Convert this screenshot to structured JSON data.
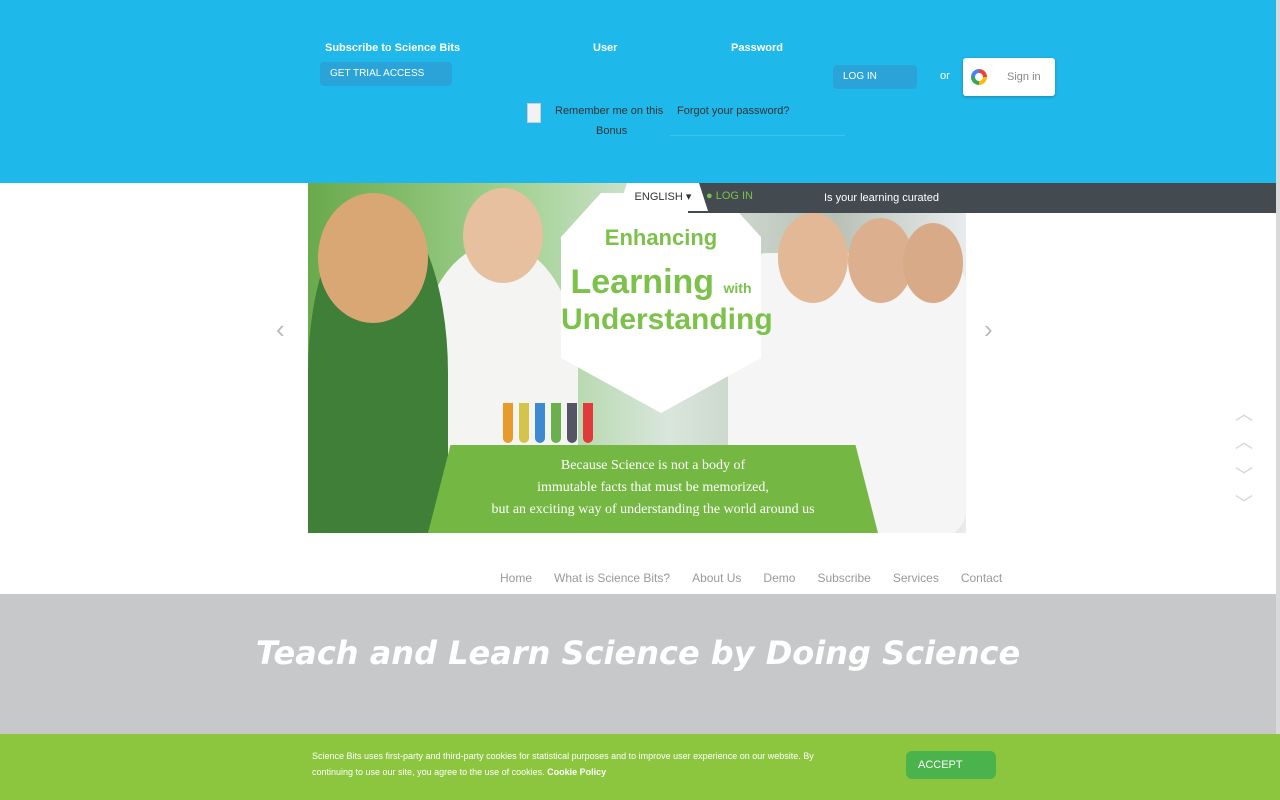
{
  "topbar": {
    "subscribe_label": "Subscribe to Science Bits",
    "subscribe_button": "GET TRIAL ACCESS",
    "user_label": "User",
    "password_label": "Password",
    "login_button": "LOG IN",
    "or_text": "or",
    "google_label": "Sign in",
    "remember_text": "Remember me on this",
    "forgot_link": "Forgot your password?",
    "bonus_text": "Bonus"
  },
  "overlay": {
    "language": "ENGLISH",
    "login": "LOG IN",
    "tagline": "Is your learning curated"
  },
  "slider": {
    "hex_line1": "Enhancing",
    "hex_line2": "Learning",
    "hex_line2_small": "with",
    "hex_line3": "Understanding",
    "caption_line1": "Because Science is not a body of",
    "caption_line2": "immutable facts that must be memorized,",
    "caption_line3": "but an exciting way of understanding the world around us",
    "arrow_left": "‹",
    "arrow_right": "›"
  },
  "side_nav": [
    "︿",
    "︿",
    "﹀",
    "﹀"
  ],
  "nav": {
    "items": [
      "Home",
      "What is Science Bits?",
      "About Us",
      "Demo",
      "Subscribe",
      "Services",
      "Contact"
    ]
  },
  "banner": {
    "title": "Teach and Learn Science by Doing Science"
  },
  "cookie": {
    "text": "Science Bits uses first-party and third-party cookies for statistical purposes and to improve user experience on our website. By continuing to use our site, you agree to the use of cookies.",
    "link": "Cookie Policy",
    "accept": "ACCEPT"
  },
  "colors": {
    "topbar": "#1fb8ea",
    "accent_green": "#8cc63f",
    "overlay_dark": "#444b50",
    "grey_band": "#c7c8ca"
  }
}
